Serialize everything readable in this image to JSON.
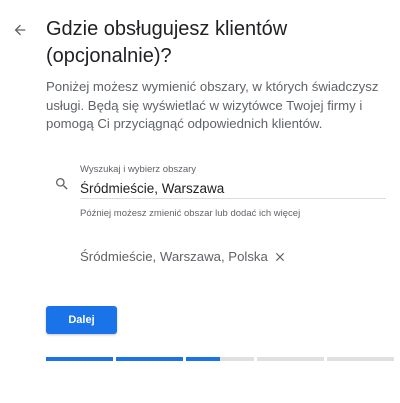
{
  "header": {
    "back_icon": "arrow-back-icon",
    "title": "Gdzie obsługujesz klientów (opcjonalnie)?"
  },
  "description": "Poniżej możesz wymienić obszary, w których świadczysz usługi. Będą się wyświetlać w wizytówce Twojej firmy i pomogą Ci przyciągnąć odpowiednich klientów.",
  "search": {
    "icon": "search-icon",
    "label": "Wyszukaj i wybierz obszary",
    "value": "Śródmieście, Warszawa",
    "helper": "Później możesz zmienić obszar lub dodać ich więcej"
  },
  "selected_areas": [
    {
      "label": "Śródmieście, Warszawa, Polska",
      "remove_icon": "close-icon"
    }
  ],
  "actions": {
    "next_label": "Dalej"
  },
  "progress": {
    "segments": [
      1,
      1,
      0.5,
      0,
      0
    ],
    "accent": "#1a73e8",
    "track": "#e0e0e0"
  },
  "colors": {
    "primary": "#1a73e8",
    "text": "#202124",
    "secondary_text": "#5f6368"
  }
}
